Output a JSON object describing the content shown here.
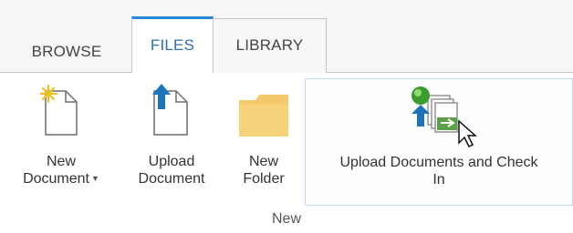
{
  "ribbon": {
    "tabs": [
      {
        "label": "BROWSE"
      },
      {
        "label": "FILES"
      },
      {
        "label": "LIBRARY"
      }
    ],
    "active_tab": "FILES",
    "items": {
      "new_document": {
        "line1": "New",
        "line2": "Document",
        "has_dropdown": true,
        "icon": "new-document-icon"
      },
      "upload_document": {
        "line1": "Upload",
        "line2": "Document",
        "icon": "upload-document-icon"
      },
      "new_folder": {
        "line1": "New",
        "line2": "Folder",
        "icon": "folder-icon"
      },
      "upload_and_checkin": {
        "line1": "Upload Documents and Check",
        "line2": "In",
        "icon": "upload-checkin-icon"
      }
    },
    "group_label": "New"
  },
  "colors": {
    "active_tab_accent": "#2b88d8",
    "active_tab_text": "#2b6fb5",
    "folder": "#f3c96b",
    "upload_arrow": "#1e73be"
  }
}
